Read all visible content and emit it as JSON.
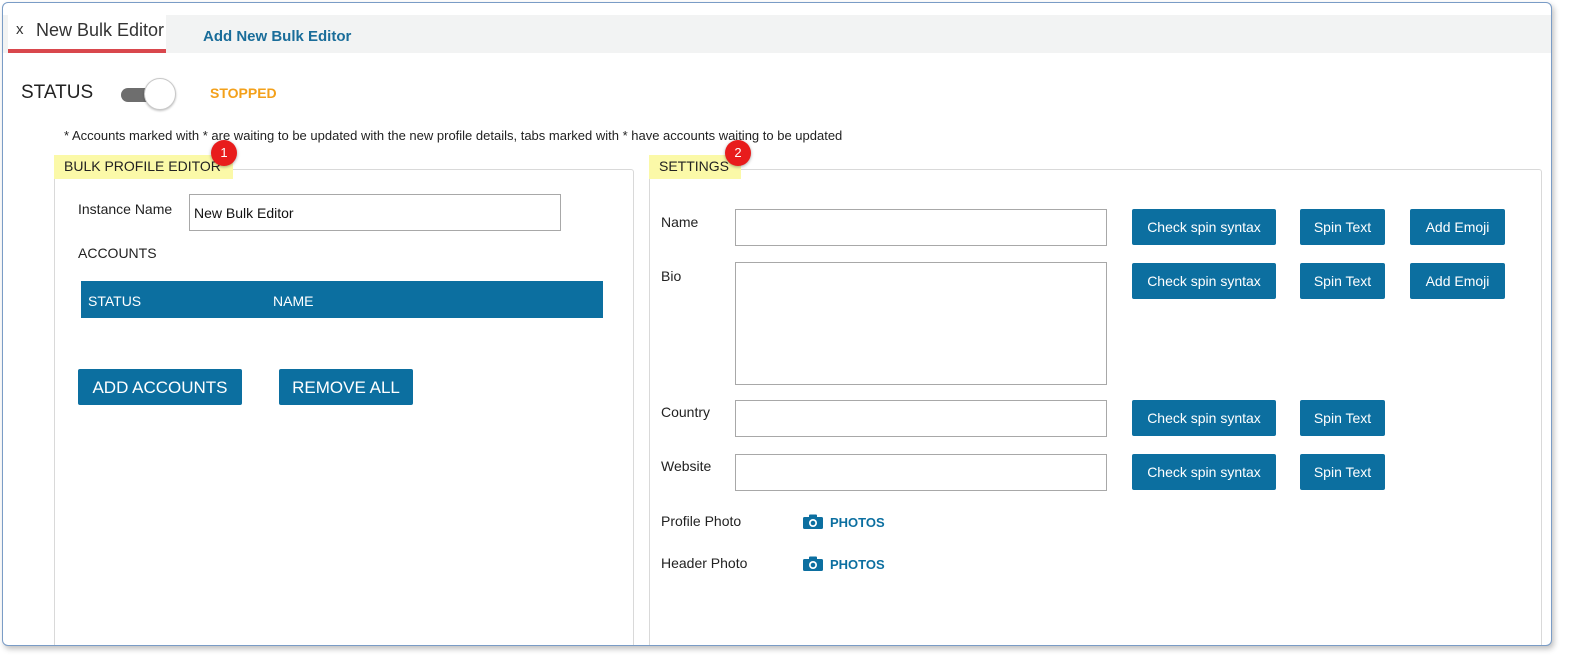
{
  "tabs": {
    "close": "x",
    "active_title": "New Bulk Editor",
    "add_label": "Add New Bulk Editor"
  },
  "status": {
    "label": "STATUS",
    "value": "STOPPED",
    "toggle_on": false
  },
  "note": "* Accounts marked with * are waiting to be updated with the new profile details, tabs marked with * have accounts waiting to be updated",
  "badges": [
    "1",
    "2"
  ],
  "bulk_editor": {
    "title": "BULK PROFILE EDITOR",
    "instance_label": "Instance Name",
    "instance_value": "New Bulk Editor",
    "accounts_label": "ACCOUNTS",
    "columns": [
      "STATUS",
      "NAME"
    ],
    "add_button": "ADD ACCOUNTS",
    "remove_button": "REMOVE ALL"
  },
  "settings": {
    "title": "SETTINGS",
    "fields": {
      "name": {
        "label": "Name",
        "value": ""
      },
      "bio": {
        "label": "Bio",
        "value": ""
      },
      "country": {
        "label": "Country",
        "value": ""
      },
      "website": {
        "label": "Website",
        "value": ""
      }
    },
    "check_spin": "Check spin syntax",
    "spin_text": "Spin Text",
    "add_emoji": "Add Emoji",
    "profile_photo_label": "Profile Photo",
    "header_photo_label": "Header Photo",
    "photos_link": "PHOTOS"
  },
  "colors": {
    "accent": "#0c6fa0",
    "status_stopped": "#f3a01a",
    "tab_underline": "#d9474d",
    "section_highlight": "#fbf9a8",
    "badge": "#e81c1c"
  },
  "icons": {
    "camera": "camera-icon"
  }
}
